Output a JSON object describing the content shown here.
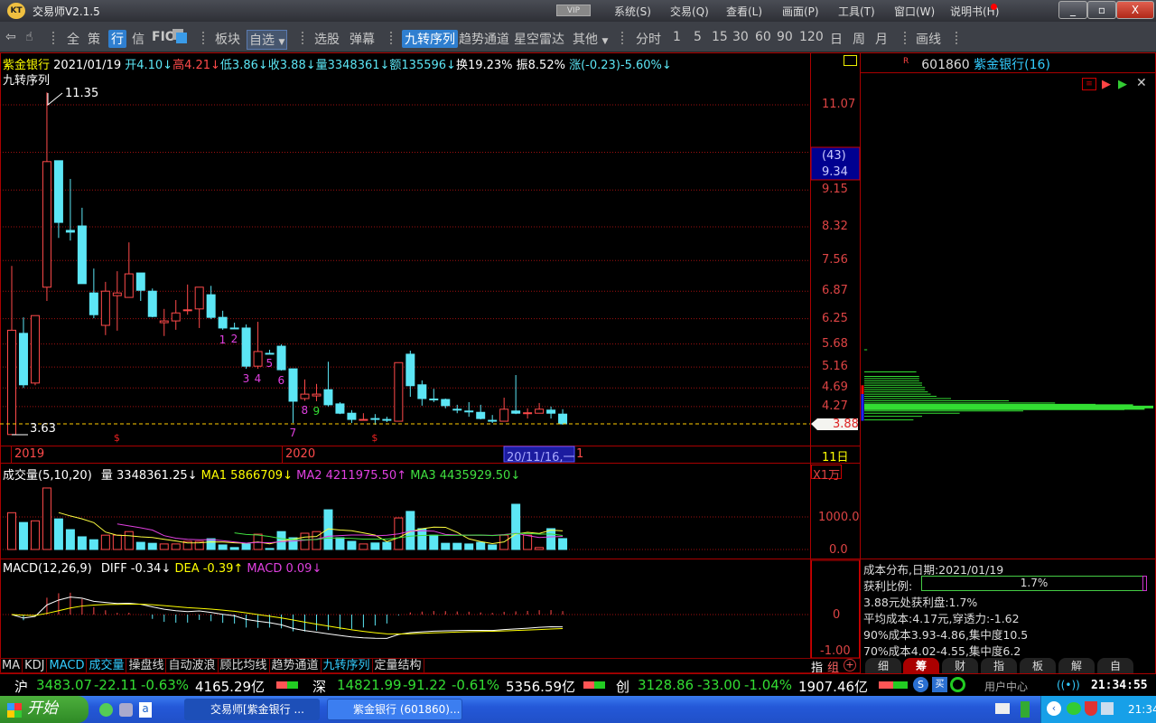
{
  "app": {
    "title": "交易师V2.1.5",
    "vip": "VIP",
    "menus": [
      "系统(S)",
      "交易(Q)",
      "查看(L)",
      "画面(P)",
      "工具(T)",
      "窗口(W)",
      "说明书(H)"
    ]
  },
  "toolbar": {
    "left": [
      "全",
      "策",
      "行",
      "信",
      "FIO"
    ],
    "board": "板块",
    "watch": "自选",
    "pick": "选股",
    "barrage": "弹幕",
    "indicators": [
      "九转序列",
      "趋势通道",
      "星空雷达",
      "其他"
    ],
    "periods": [
      "分时",
      "1",
      "5",
      "15",
      "30",
      "60",
      "90",
      "120",
      "日",
      "周",
      "月"
    ],
    "draw": "画线"
  },
  "header": {
    "name": "紫金银行",
    "date": "2021/01/19",
    "open": "开4.10↓",
    "high": "高4.21↓",
    "low": "低3.86↓",
    "close": "收3.88↓",
    "vol": "量3348361↓",
    "amount": "额135596↓",
    "turnover": "换19.23%",
    "amplitude": "振8.52%",
    "change": "涨(-0.23)-5.60%↓",
    "indicator": "九转序列"
  },
  "price_axis": {
    "labels": [
      "11.07",
      "9.15",
      "8.32",
      "7.56",
      "6.87",
      "6.25",
      "5.68",
      "5.16",
      "4.69",
      "4.27"
    ],
    "cursor_count": "(43)",
    "cursor_price": "9.34",
    "last_price": "3.88",
    "period": "11日"
  },
  "annotations": {
    "max": "11.35",
    "min": "3.63",
    "years": [
      "2019",
      "2020"
    ],
    "cursor_date": "20/11/16,一",
    "cursor_tail": "1",
    "td_marks": [
      "1",
      "2",
      "3",
      "4",
      "5",
      "6",
      "7",
      "8",
      "9"
    ],
    "dollar": "$"
  },
  "volume": {
    "title": "成交量(5,10,20)",
    "vol": "量 3348361.25↓",
    "ma1": "MA1 5866709↓",
    "ma2": "MA2 4211975.50↑",
    "ma3": "MA3 4435929.50↓",
    "unit": "X1万",
    "axis": [
      "1000.0",
      "0.0"
    ]
  },
  "macd": {
    "title": "MACD(12,26,9)",
    "diff": "DIFF -0.34↓",
    "dea": "DEA -0.39↑",
    "macd": "MACD 0.09↓",
    "axis": [
      "0",
      "-1.00"
    ]
  },
  "bottom_tabs": [
    "MA",
    "KDJ",
    "MACD",
    "成交量",
    "操盘线",
    "自动波浪",
    "顾比均线",
    "趋势通道",
    "九转序列",
    "定量结构"
  ],
  "bottom_right": {
    "ind": "指",
    "group": "组",
    "plus": "+"
  },
  "right": {
    "code": "601860",
    "name": "紫金银行",
    "count": "(16)",
    "flag": "R",
    "cost_title": "成本分布,日期:2021/01/19",
    "profit_label": "获利比例:",
    "profit_value": "1.7%",
    "profit_ratio": 0.017,
    "lines": [
      "3.88元处获利盘:1.7%",
      "平均成本:4.17元,穿透力:-1.62",
      "90%成本3.93-4.86,集中度10.5",
      "70%成本4.02-4.55,集中度6.2"
    ],
    "tabs": [
      "细",
      "筹",
      "财",
      "指",
      "板",
      "解",
      "自"
    ],
    "chip_distribution": [
      [
        5.55,
        0.01
      ],
      [
        5.05,
        0.18
      ],
      [
        4.95,
        0.19
      ],
      [
        4.9,
        0.19
      ],
      [
        4.85,
        0.19
      ],
      [
        4.8,
        0.2
      ],
      [
        4.75,
        0.2
      ],
      [
        4.7,
        0.21
      ],
      [
        4.65,
        0.21
      ],
      [
        4.6,
        0.22
      ],
      [
        4.55,
        0.23
      ],
      [
        4.5,
        0.25
      ],
      [
        4.45,
        0.3
      ],
      [
        4.4,
        0.5
      ],
      [
        4.35,
        0.66
      ],
      [
        4.32,
        0.8
      ],
      [
        4.29,
        0.93
      ],
      [
        4.26,
        1.0
      ],
      [
        4.23,
        0.97
      ],
      [
        4.2,
        0.9
      ],
      [
        4.17,
        0.55
      ],
      [
        4.12,
        0.33
      ],
      [
        4.05,
        0.2
      ],
      [
        3.97,
        0.17
      ]
    ]
  },
  "indexbar": {
    "sh": {
      "name": "沪",
      "price": "3483.07",
      "chg": "-22.11",
      "pct": "-0.63%",
      "amt": "4165.29亿"
    },
    "sz": {
      "name": "深",
      "price": "14821.99",
      "chg": "-91.22",
      "pct": "-0.61%",
      "amt": "5356.59亿"
    },
    "cy": {
      "name": "创",
      "price": "3128.86",
      "chg": "-33.00",
      "pct": "-1.04%",
      "amt": "1907.46亿"
    },
    "user_center": "用户中心",
    "clock": "21:34:55"
  },
  "taskbar": {
    "start": "开始",
    "tasks": [
      "交易师[紫金银行 ...",
      "紫金银行 (601860)..."
    ],
    "time": "21:34"
  },
  "colors": {
    "up": "#ff4a4a",
    "down": "#5ce6f5",
    "grid": "#a01010",
    "ma1": "#ffff40",
    "ma2": "#e040e0",
    "ma3": "#40e040"
  },
  "chart_data": {
    "type": "candlestick",
    "ohlc": [
      [
        3.64,
        7.44,
        3.63,
        5.99
      ],
      [
        5.92,
        6.28,
        4.69,
        4.76
      ],
      [
        4.8,
        6.32,
        4.75,
        6.32
      ],
      [
        6.96,
        11.35,
        6.65,
        9.79
      ],
      [
        9.81,
        9.81,
        8.07,
        8.42
      ],
      [
        8.24,
        9.4,
        8.01,
        8.2
      ],
      [
        8.34,
        8.75,
        7.04,
        7.04
      ],
      [
        6.83,
        7.38,
        6.26,
        6.34
      ],
      [
        6.1,
        7.08,
        5.88,
        6.87
      ],
      [
        6.77,
        7.32,
        5.98,
        6.83
      ],
      [
        6.73,
        7.97,
        6.73,
        7.26
      ],
      [
        7.28,
        7.28,
        6.65,
        6.89
      ],
      [
        6.87,
        6.93,
        6.28,
        6.3
      ],
      [
        6.16,
        6.47,
        5.86,
        6.2
      ],
      [
        6.2,
        6.67,
        6.0,
        6.38
      ],
      [
        6.44,
        7.02,
        6.34,
        6.45
      ],
      [
        6.47,
        6.96,
        6.04,
        6.96
      ],
      [
        6.79,
        6.99,
        6.24,
        6.28
      ],
      [
        6.28,
        6.43,
        6.0,
        6.04
      ],
      [
        6.04,
        6.16,
        6.02,
        6.03
      ],
      [
        6.04,
        6.12,
        5.12,
        5.18
      ],
      [
        5.18,
        6.18,
        5.12,
        5.51
      ],
      [
        5.47,
        5.55,
        5.46,
        5.46
      ],
      [
        5.63,
        5.67,
        5.08,
        5.1
      ],
      [
        5.12,
        5.12,
        3.9,
        4.39
      ],
      [
        4.45,
        4.88,
        4.4,
        4.55
      ],
      [
        4.51,
        4.78,
        4.39,
        4.55
      ],
      [
        4.65,
        5.28,
        4.27,
        4.31
      ],
      [
        4.33,
        4.37,
        4.1,
        4.12
      ],
      [
        4.12,
        4.19,
        3.9,
        3.98
      ],
      [
        3.97,
        4.12,
        3.97,
        3.98
      ],
      [
        4.0,
        4.1,
        3.86,
        3.99
      ],
      [
        3.98,
        4.04,
        3.92,
        3.97
      ],
      [
        3.94,
        5.26,
        3.94,
        5.26
      ],
      [
        5.45,
        5.53,
        4.49,
        4.74
      ],
      [
        4.76,
        4.86,
        4.29,
        4.45
      ],
      [
        4.44,
        4.67,
        4.37,
        4.42
      ],
      [
        4.43,
        4.45,
        4.23,
        4.29
      ],
      [
        4.21,
        4.31,
        4.12,
        4.2
      ],
      [
        4.17,
        4.37,
        4.04,
        4.16
      ],
      [
        4.14,
        4.31,
        3.98,
        4.0
      ],
      [
        3.96,
        4.08,
        3.9,
        3.95
      ],
      [
        3.94,
        4.47,
        3.94,
        4.21
      ],
      [
        4.17,
        4.98,
        4.1,
        4.12
      ],
      [
        4.12,
        4.23,
        4.0,
        4.13
      ],
      [
        4.12,
        4.35,
        4.12,
        4.21
      ],
      [
        4.19,
        4.27,
        4.0,
        4.12
      ],
      [
        4.1,
        4.21,
        3.86,
        3.88
      ]
    ],
    "volume_wan": [
      1130,
      830,
      880,
      1890,
      940,
      610,
      390,
      300,
      440,
      440,
      550,
      220,
      190,
      170,
      170,
      250,
      250,
      330,
      140,
      60,
      170,
      470,
      30,
      550,
      360,
      500,
      550,
      1220,
      360,
      250,
      170,
      200,
      220,
      970,
      1170,
      640,
      440,
      190,
      190,
      170,
      220,
      140,
      440,
      1390,
      440,
      60,
      640,
      335
    ],
    "price_grid": [
      11.07,
      10.0,
      9.15,
      8.32,
      7.56,
      6.87,
      6.25,
      5.68,
      5.16,
      4.69,
      4.27
    ],
    "td_index": [
      18,
      19,
      20,
      21,
      22,
      23,
      24,
      25,
      26
    ],
    "dollar_index": [
      9,
      31
    ],
    "ylim": [
      3.5,
      11.5
    ]
  }
}
